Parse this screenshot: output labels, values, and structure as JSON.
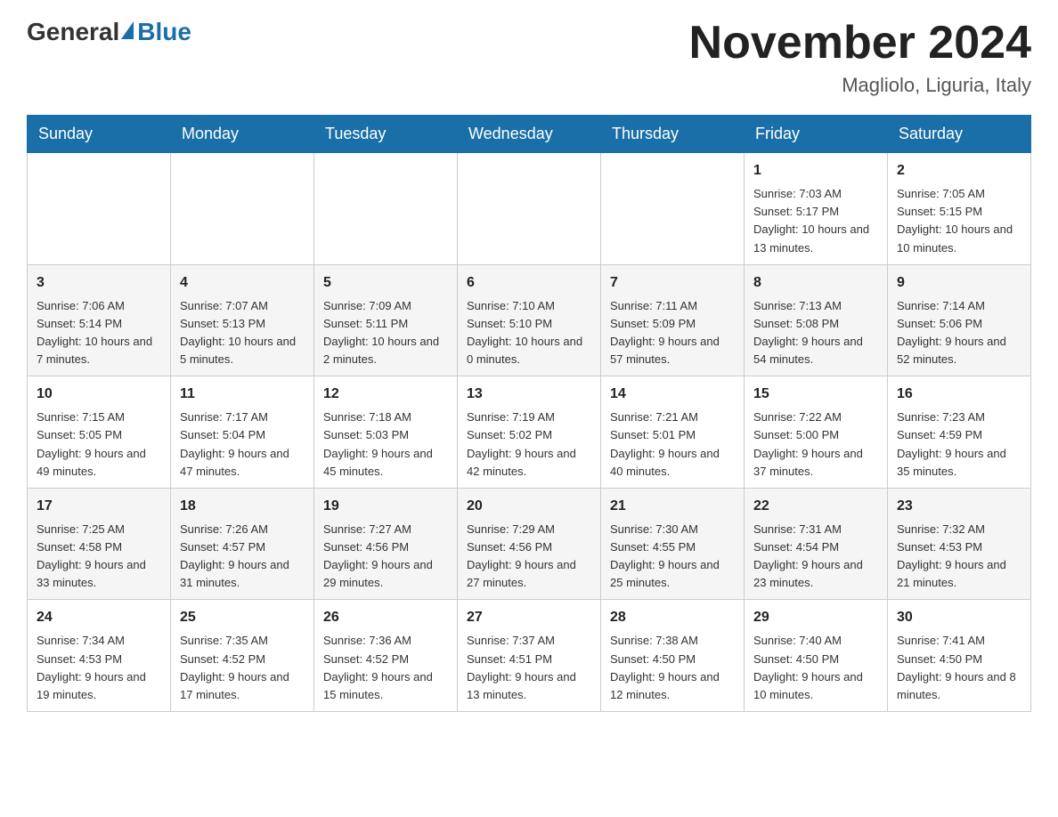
{
  "header": {
    "logo_general": "General",
    "logo_blue": "Blue",
    "title": "November 2024",
    "subtitle": "Magliolo, Liguria, Italy"
  },
  "days_of_week": [
    "Sunday",
    "Monday",
    "Tuesday",
    "Wednesday",
    "Thursday",
    "Friday",
    "Saturday"
  ],
  "weeks": [
    [
      {
        "day": "",
        "sunrise": "",
        "sunset": "",
        "daylight": ""
      },
      {
        "day": "",
        "sunrise": "",
        "sunset": "",
        "daylight": ""
      },
      {
        "day": "",
        "sunrise": "",
        "sunset": "",
        "daylight": ""
      },
      {
        "day": "",
        "sunrise": "",
        "sunset": "",
        "daylight": ""
      },
      {
        "day": "",
        "sunrise": "",
        "sunset": "",
        "daylight": ""
      },
      {
        "day": "1",
        "sunrise": "Sunrise: 7:03 AM",
        "sunset": "Sunset: 5:17 PM",
        "daylight": "Daylight: 10 hours and 13 minutes."
      },
      {
        "day": "2",
        "sunrise": "Sunrise: 7:05 AM",
        "sunset": "Sunset: 5:15 PM",
        "daylight": "Daylight: 10 hours and 10 minutes."
      }
    ],
    [
      {
        "day": "3",
        "sunrise": "Sunrise: 7:06 AM",
        "sunset": "Sunset: 5:14 PM",
        "daylight": "Daylight: 10 hours and 7 minutes."
      },
      {
        "day": "4",
        "sunrise": "Sunrise: 7:07 AM",
        "sunset": "Sunset: 5:13 PM",
        "daylight": "Daylight: 10 hours and 5 minutes."
      },
      {
        "day": "5",
        "sunrise": "Sunrise: 7:09 AM",
        "sunset": "Sunset: 5:11 PM",
        "daylight": "Daylight: 10 hours and 2 minutes."
      },
      {
        "day": "6",
        "sunrise": "Sunrise: 7:10 AM",
        "sunset": "Sunset: 5:10 PM",
        "daylight": "Daylight: 10 hours and 0 minutes."
      },
      {
        "day": "7",
        "sunrise": "Sunrise: 7:11 AM",
        "sunset": "Sunset: 5:09 PM",
        "daylight": "Daylight: 9 hours and 57 minutes."
      },
      {
        "day": "8",
        "sunrise": "Sunrise: 7:13 AM",
        "sunset": "Sunset: 5:08 PM",
        "daylight": "Daylight: 9 hours and 54 minutes."
      },
      {
        "day": "9",
        "sunrise": "Sunrise: 7:14 AM",
        "sunset": "Sunset: 5:06 PM",
        "daylight": "Daylight: 9 hours and 52 minutes."
      }
    ],
    [
      {
        "day": "10",
        "sunrise": "Sunrise: 7:15 AM",
        "sunset": "Sunset: 5:05 PM",
        "daylight": "Daylight: 9 hours and 49 minutes."
      },
      {
        "day": "11",
        "sunrise": "Sunrise: 7:17 AM",
        "sunset": "Sunset: 5:04 PM",
        "daylight": "Daylight: 9 hours and 47 minutes."
      },
      {
        "day": "12",
        "sunrise": "Sunrise: 7:18 AM",
        "sunset": "Sunset: 5:03 PM",
        "daylight": "Daylight: 9 hours and 45 minutes."
      },
      {
        "day": "13",
        "sunrise": "Sunrise: 7:19 AM",
        "sunset": "Sunset: 5:02 PM",
        "daylight": "Daylight: 9 hours and 42 minutes."
      },
      {
        "day": "14",
        "sunrise": "Sunrise: 7:21 AM",
        "sunset": "Sunset: 5:01 PM",
        "daylight": "Daylight: 9 hours and 40 minutes."
      },
      {
        "day": "15",
        "sunrise": "Sunrise: 7:22 AM",
        "sunset": "Sunset: 5:00 PM",
        "daylight": "Daylight: 9 hours and 37 minutes."
      },
      {
        "day": "16",
        "sunrise": "Sunrise: 7:23 AM",
        "sunset": "Sunset: 4:59 PM",
        "daylight": "Daylight: 9 hours and 35 minutes."
      }
    ],
    [
      {
        "day": "17",
        "sunrise": "Sunrise: 7:25 AM",
        "sunset": "Sunset: 4:58 PM",
        "daylight": "Daylight: 9 hours and 33 minutes."
      },
      {
        "day": "18",
        "sunrise": "Sunrise: 7:26 AM",
        "sunset": "Sunset: 4:57 PM",
        "daylight": "Daylight: 9 hours and 31 minutes."
      },
      {
        "day": "19",
        "sunrise": "Sunrise: 7:27 AM",
        "sunset": "Sunset: 4:56 PM",
        "daylight": "Daylight: 9 hours and 29 minutes."
      },
      {
        "day": "20",
        "sunrise": "Sunrise: 7:29 AM",
        "sunset": "Sunset: 4:56 PM",
        "daylight": "Daylight: 9 hours and 27 minutes."
      },
      {
        "day": "21",
        "sunrise": "Sunrise: 7:30 AM",
        "sunset": "Sunset: 4:55 PM",
        "daylight": "Daylight: 9 hours and 25 minutes."
      },
      {
        "day": "22",
        "sunrise": "Sunrise: 7:31 AM",
        "sunset": "Sunset: 4:54 PM",
        "daylight": "Daylight: 9 hours and 23 minutes."
      },
      {
        "day": "23",
        "sunrise": "Sunrise: 7:32 AM",
        "sunset": "Sunset: 4:53 PM",
        "daylight": "Daylight: 9 hours and 21 minutes."
      }
    ],
    [
      {
        "day": "24",
        "sunrise": "Sunrise: 7:34 AM",
        "sunset": "Sunset: 4:53 PM",
        "daylight": "Daylight: 9 hours and 19 minutes."
      },
      {
        "day": "25",
        "sunrise": "Sunrise: 7:35 AM",
        "sunset": "Sunset: 4:52 PM",
        "daylight": "Daylight: 9 hours and 17 minutes."
      },
      {
        "day": "26",
        "sunrise": "Sunrise: 7:36 AM",
        "sunset": "Sunset: 4:52 PM",
        "daylight": "Daylight: 9 hours and 15 minutes."
      },
      {
        "day": "27",
        "sunrise": "Sunrise: 7:37 AM",
        "sunset": "Sunset: 4:51 PM",
        "daylight": "Daylight: 9 hours and 13 minutes."
      },
      {
        "day": "28",
        "sunrise": "Sunrise: 7:38 AM",
        "sunset": "Sunset: 4:50 PM",
        "daylight": "Daylight: 9 hours and 12 minutes."
      },
      {
        "day": "29",
        "sunrise": "Sunrise: 7:40 AM",
        "sunset": "Sunset: 4:50 PM",
        "daylight": "Daylight: 9 hours and 10 minutes."
      },
      {
        "day": "30",
        "sunrise": "Sunrise: 7:41 AM",
        "sunset": "Sunset: 4:50 PM",
        "daylight": "Daylight: 9 hours and 8 minutes."
      }
    ]
  ]
}
